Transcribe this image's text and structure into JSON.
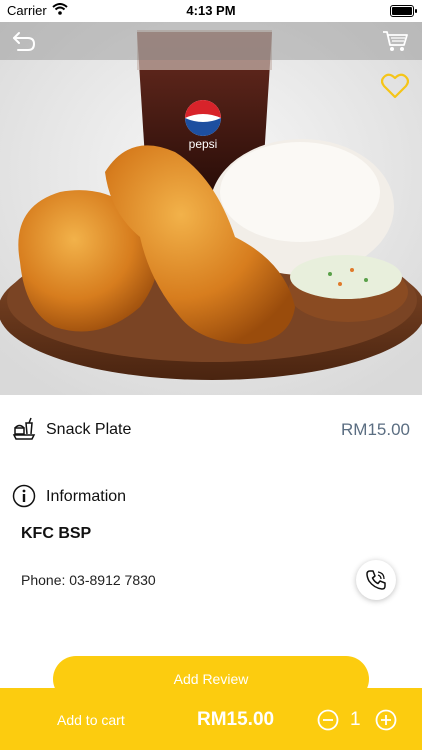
{
  "status_bar": {
    "carrier": "Carrier",
    "time": "4:13 PM"
  },
  "nav": {
    "back_icon": "back-arrow-icon",
    "cart_icon": "cart-icon"
  },
  "hero": {
    "image": "fried-chicken-meal-photo",
    "favorite_icon": "heart-icon"
  },
  "product": {
    "name": "Snack Plate",
    "price": "RM15.00",
    "icon": "food-tray-icon"
  },
  "information": {
    "title": "Information",
    "icon": "info-icon",
    "store": "KFC BSP",
    "phone": "Phone: 03-8912 7830",
    "call_icon": "phone-icon"
  },
  "review": {
    "label": "Add Review"
  },
  "bottom_bar": {
    "add_to_cart": "Add to cart",
    "total": "RM15.00",
    "quantity": "1"
  },
  "colors": {
    "accent": "#fccc0f",
    "price": "#5b6e82"
  }
}
